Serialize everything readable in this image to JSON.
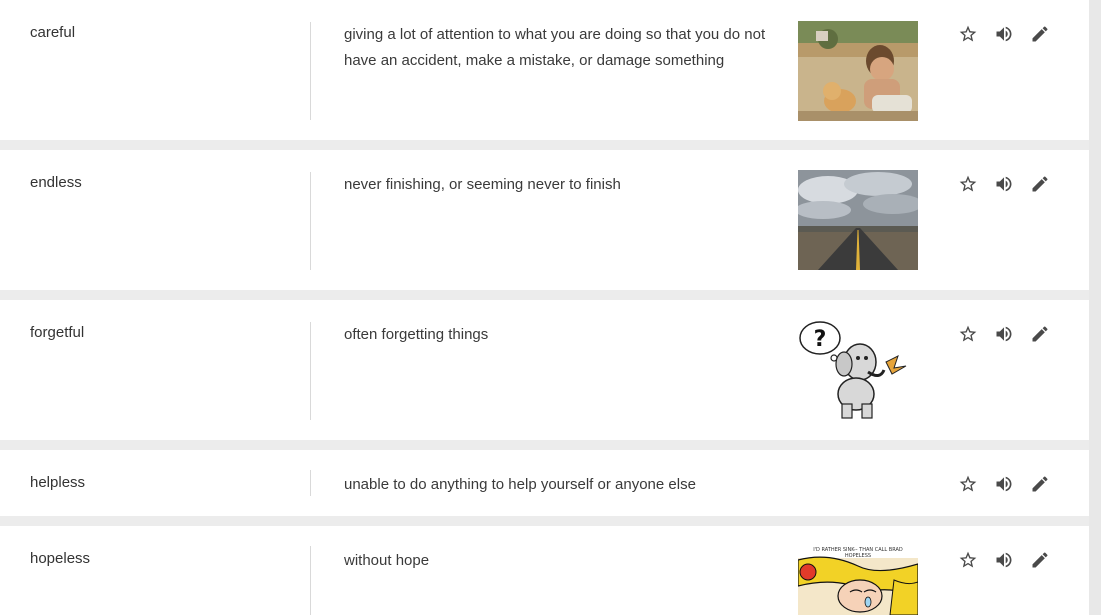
{
  "entries": [
    {
      "word": "careful",
      "definition": "giving a lot of attention to what you are doing so that you do not have an accident, make a mistake, or damage something"
    },
    {
      "word": "endless",
      "definition": "never finishing, or seeming never to finish"
    },
    {
      "word": "forgetful",
      "definition": "often forgetting things"
    },
    {
      "word": "helpless",
      "definition": "unable to do anything to help yourself or anyone else"
    },
    {
      "word": "hopeless",
      "definition": "without hope"
    }
  ],
  "images": {
    "forgetful_mark": "?",
    "hopeless_text_line1": "I'D RATHER SINK-- THAN CALL BRAD",
    "hopeless_text_line2": "HOPELESS"
  },
  "icons": {
    "favorite": "star-outline-icon",
    "pronounce": "volume-icon",
    "edit": "pencil-icon"
  },
  "colors": {
    "background": "#ececec",
    "card": "#ffffff",
    "divider": "#d9d9d9",
    "icon": "#4a4a4a",
    "text": "#333333"
  }
}
